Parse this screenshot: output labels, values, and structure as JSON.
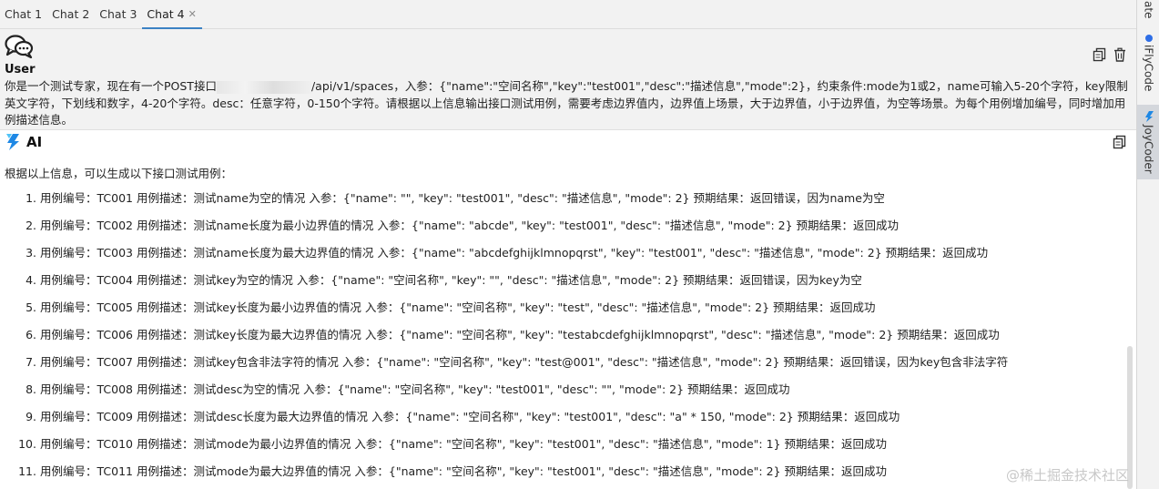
{
  "tabs": [
    {
      "label": "Chat 1",
      "active": false,
      "closable": false
    },
    {
      "label": "Chat 2",
      "active": false,
      "closable": false
    },
    {
      "label": "Chat 3",
      "active": false,
      "closable": false
    },
    {
      "label": "Chat 4",
      "active": true,
      "closable": true
    }
  ],
  "sidebar": {
    "top_label": "ate",
    "iflycode_label": "iFlyCode",
    "joycoder_label": "JoyCoder"
  },
  "user_message": {
    "label": "User",
    "text_before": "你是一个测试专家，现在有一个POST接口",
    "text_after": "/api/v1/spaces，入参：{\"name\":\"空间名称\",\"key\":\"test001\",\"desc\":\"描述信息\",\"mode\":2}，约束条件:mode为1或2，name可输入5-20个字符，key限制英文字符，下划线和数字，4-20个字符。desc：任意字符，0-150个字符。请根据以上信息输出接口测试用例，需要考虑边界值内，边界值上场景，大于边界值，小于边界值，为空等场景。为每个用例增加编号，同时增加用例描述信息。"
  },
  "ai_message": {
    "label": "AI",
    "intro": "根据以上信息，可以生成以下接口测试用例：",
    "cases": [
      {
        "num": "1.",
        "text": "用例编号：TC001 用例描述：测试name为空的情况 入参：{\"name\": \"\", \"key\": \"test001\", \"desc\": \"描述信息\", \"mode\": 2} 预期结果：返回错误，因为name为空"
      },
      {
        "num": "2.",
        "text": "用例编号：TC002 用例描述：测试name长度为最小边界值的情况 入参：{\"name\": \"abcde\", \"key\": \"test001\", \"desc\": \"描述信息\", \"mode\": 2} 预期结果：返回成功"
      },
      {
        "num": "3.",
        "text": "用例编号：TC003 用例描述：测试name长度为最大边界值的情况 入参：{\"name\": \"abcdefghijklmnopqrst\", \"key\": \"test001\", \"desc\": \"描述信息\", \"mode\": 2} 预期结果：返回成功"
      },
      {
        "num": "4.",
        "text": "用例编号：TC004 用例描述：测试key为空的情况 入参：{\"name\": \"空间名称\", \"key\": \"\", \"desc\": \"描述信息\", \"mode\": 2} 预期结果：返回错误，因为key为空"
      },
      {
        "num": "5.",
        "text": "用例编号：TC005 用例描述：测试key长度为最小边界值的情况 入参：{\"name\": \"空间名称\", \"key\": \"test\", \"desc\": \"描述信息\", \"mode\": 2} 预期结果：返回成功"
      },
      {
        "num": "6.",
        "text": "用例编号：TC006 用例描述：测试key长度为最大边界值的情况 入参：{\"name\": \"空间名称\", \"key\": \"testabcdefghijklmnopqrst\", \"desc\": \"描述信息\", \"mode\": 2} 预期结果：返回成功"
      },
      {
        "num": "7.",
        "text": "用例编号：TC007 用例描述：测试key包含非法字符的情况 入参：{\"name\": \"空间名称\", \"key\": \"test@001\", \"desc\": \"描述信息\", \"mode\": 2} 预期结果：返回错误，因为key包含非法字符"
      },
      {
        "num": "8.",
        "text": "用例编号：TC008 用例描述：测试desc为空的情况 入参：{\"name\": \"空间名称\", \"key\": \"test001\", \"desc\": \"\", \"mode\": 2} 预期结果：返回成功"
      },
      {
        "num": "9.",
        "text": "用例编号：TC009 用例描述：测试desc长度为最大边界值的情况 入参：{\"name\": \"空间名称\", \"key\": \"test001\", \"desc\": \"a\" * 150, \"mode\": 2} 预期结果：返回成功"
      },
      {
        "num": "10.",
        "text": "用例编号：TC010 用例描述：测试mode为最小边界值的情况 入参：{\"name\": \"空间名称\", \"key\": \"test001\", \"desc\": \"描述信息\", \"mode\": 1} 预期结果：返回成功"
      },
      {
        "num": "11.",
        "text": "用例编号：TC011 用例描述：测试mode为最大边界值的情况 入参：{\"name\": \"空间名称\", \"key\": \"test001\", \"desc\": \"描述信息\", \"mode\": 2} 预期结果：返回成功"
      }
    ]
  },
  "watermark": "@稀土掘金技术社区",
  "colors": {
    "accent": "#3b82c4",
    "panel_bg": "#f2f2f2",
    "ai_logo": "#1e88e5"
  }
}
